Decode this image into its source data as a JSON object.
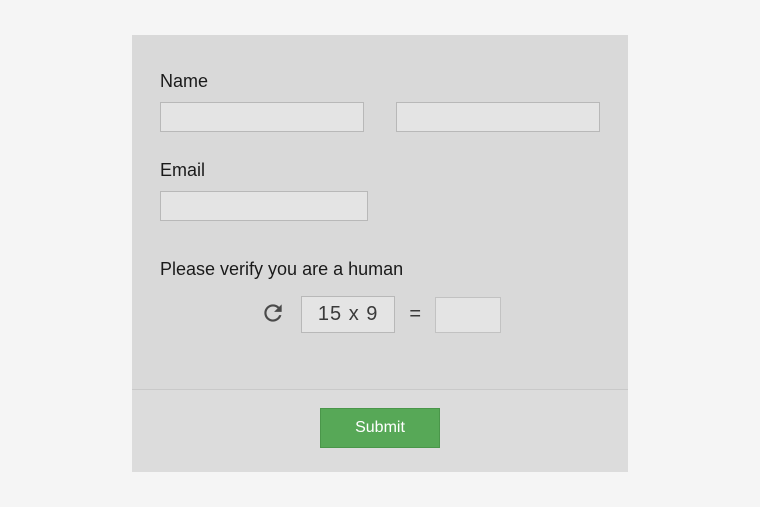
{
  "form": {
    "name_label": "Name",
    "first_name_value": "",
    "last_name_value": "",
    "email_label": "Email",
    "email_value": "",
    "captcha_label": "Please verify you are a human",
    "captcha_question": "15 x 9",
    "captcha_equals": "=",
    "captcha_answer_value": "",
    "submit_label": "Submit"
  },
  "colors": {
    "card_bg": "#d9d9d9",
    "input_border": "#b8b8b8",
    "submit_bg": "#57a857",
    "submit_text": "#ffffff"
  }
}
